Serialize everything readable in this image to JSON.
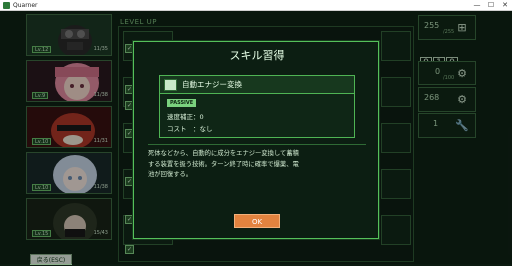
{
  "window": {
    "title": "Quarner",
    "min": "—",
    "max": "☐",
    "close": "✕"
  },
  "characters": [
    {
      "level": "Lv.12",
      "hp": "11/35"
    },
    {
      "level": "Lv.9",
      "hp": "11/38"
    },
    {
      "level": "Lv.10",
      "hp": "11/31"
    },
    {
      "level": "Lv.10",
      "hp": "11/38"
    },
    {
      "level": "Lv.15",
      "hp": "15/43"
    }
  ],
  "levelup": {
    "label": "LEVEL UP"
  },
  "stats": {
    "energy": {
      "value": "255",
      "max": "/255",
      "icon": "add-icon"
    },
    "counter": [
      "0",
      "1",
      "0"
    ],
    "capacity": {
      "value": "0",
      "max": "/100",
      "icon": "gear-chain-icon"
    },
    "resource": {
      "value": "268",
      "icon": "gears-icon"
    },
    "keys": {
      "value": "1",
      "icon": "wrench-icon"
    }
  },
  "back_button": "戻る(ESC)",
  "modal": {
    "title": "スキル習得",
    "skill": {
      "name": "自動エナジー変換",
      "badge": "PASSIVE",
      "speed": "速度補正：0",
      "cost": "コスト　：なし"
    },
    "description_line1": "死体などから、自動的に成分をエナジー変換して蓄積",
    "description_line2": "する装置を扱う技術。ターン終了時に確率で爆薬、電",
    "description_line3": "池が回復する。",
    "ok": "OK"
  },
  "colors": {
    "accent": "#55c05a",
    "ok_button": "#e3833f",
    "panel": "#0c1e12"
  }
}
